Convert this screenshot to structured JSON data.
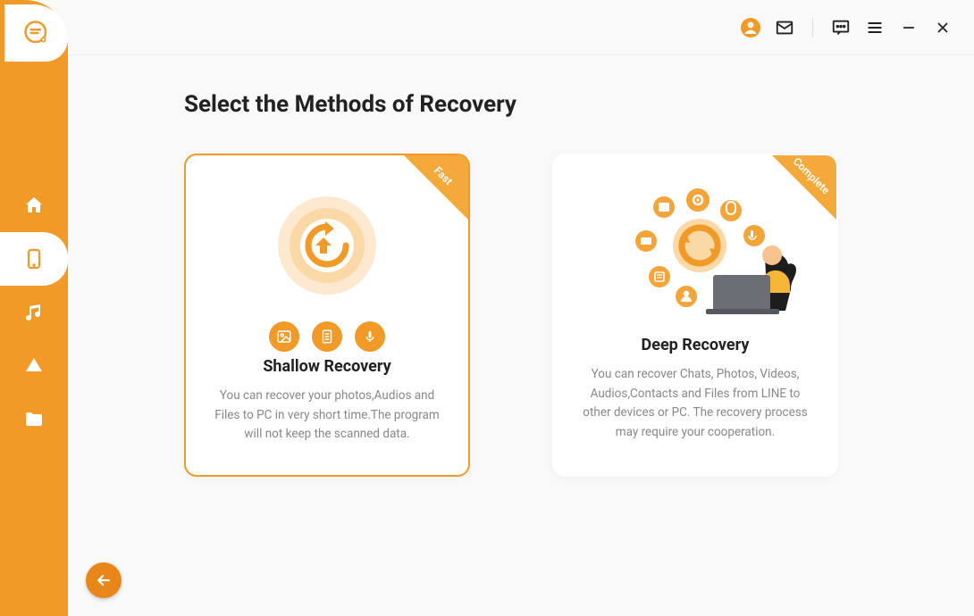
{
  "header": {
    "icons": [
      "user",
      "mail",
      "feedback",
      "menu",
      "minimize",
      "close"
    ]
  },
  "sidebar": {
    "items": [
      {
        "name": "home",
        "icon": "home"
      },
      {
        "name": "device",
        "icon": "phone",
        "active": true
      },
      {
        "name": "music",
        "icon": "music"
      },
      {
        "name": "cloud",
        "icon": "cloud"
      },
      {
        "name": "folder",
        "icon": "folder"
      }
    ]
  },
  "page": {
    "title": "Select the Methods of Recovery"
  },
  "cards": [
    {
      "ribbon": "Fast",
      "title": "Shallow Recovery",
      "desc": "You can recover your photos,Audios and Files to PC in very short time.The program will not keep the scanned data.",
      "selected": true
    },
    {
      "ribbon": "Complete",
      "title": "Deep Recovery",
      "desc": "You can recover Chats, Photos, Videos, Audios,Contacts and Files from LINE to other devices or PC. The recovery process may require your cooperation.",
      "selected": false
    }
  ],
  "back_label": "Back"
}
